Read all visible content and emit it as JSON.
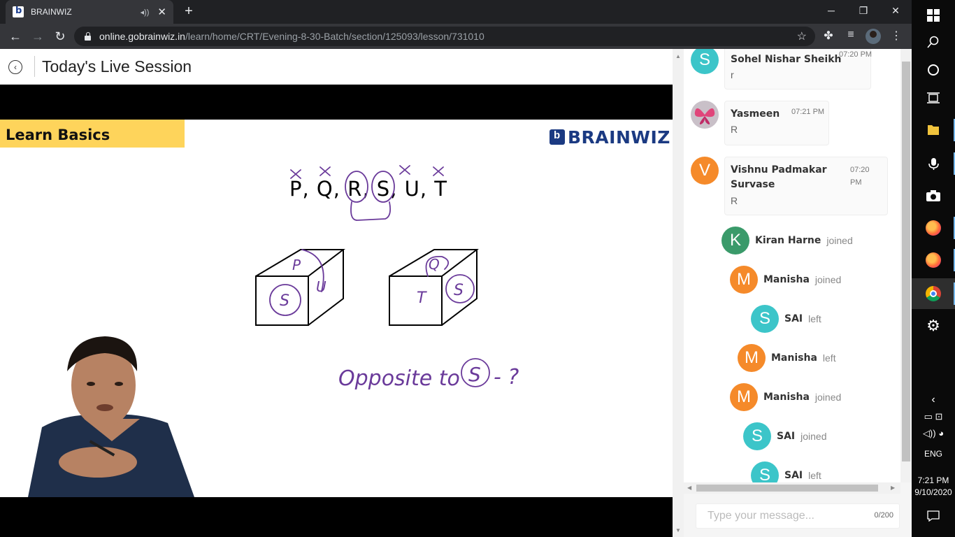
{
  "browser": {
    "tab_title": "BRAINWIZ",
    "url_host": "online.gobrainwiz.in",
    "url_path": "/learn/home/CRT/Evening-8-30-Batch/section/125093/lesson/731010"
  },
  "header": {
    "title": "Today's Live Session"
  },
  "slide": {
    "banner": "Learn Basics",
    "brand": "BRAINWIZ",
    "letters": "P, Q, R, S, U, T",
    "cube1_top": "P",
    "cube1_front": "S",
    "cube1_side": "U",
    "cube2_top": "Q",
    "cube2_front": "T",
    "cube2_side": "S",
    "handwriting": "Opposite to",
    "handwriting_circle": "S",
    "handwriting_end": "- ?"
  },
  "chat": {
    "messages": [
      {
        "initial": "S",
        "name": "Sohel Nishar Sheikh",
        "time": "07:20 PM",
        "text": "r",
        "color": "#3cc5c9"
      },
      {
        "initial": "",
        "name": "Yasmeen",
        "time": "07:21 PM",
        "text": "R",
        "color": "#c9c0c8"
      },
      {
        "initial": "V",
        "name": "Vishnu Padmakar Survase",
        "time": "07:20 PM",
        "text": "R",
        "color": "#f58a2a"
      }
    ],
    "events": [
      {
        "initial": "K",
        "name": "Kiran Harne",
        "status": "joined",
        "color": "#3a9a6a"
      },
      {
        "initial": "M",
        "name": "Manisha",
        "status": "joined",
        "color": "#f58a2a"
      },
      {
        "initial": "S",
        "name": "SAI",
        "status": "left",
        "color": "#3cc5c9"
      },
      {
        "initial": "M",
        "name": "Manisha",
        "status": "left",
        "color": "#f58a2a"
      },
      {
        "initial": "M",
        "name": "Manisha",
        "status": "joined",
        "color": "#f58a2a"
      },
      {
        "initial": "S",
        "name": "SAI",
        "status": "joined",
        "color": "#3cc5c9"
      },
      {
        "initial": "S",
        "name": "SAI",
        "status": "left",
        "color": "#3cc5c9"
      }
    ],
    "input_placeholder": "Type your message...",
    "char_count": "0/200"
  },
  "taskbar": {
    "language": "ENG",
    "time": "7:21 PM",
    "date": "9/10/2020"
  }
}
